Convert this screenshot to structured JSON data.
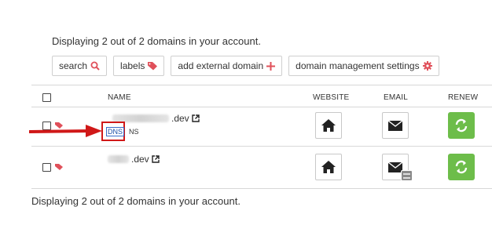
{
  "summary_text": "Displaying 2 out of 2 domains in your account.",
  "toolbar": {
    "search": "search",
    "labels": "labels",
    "add_external": "add external domain",
    "settings": "domain management settings"
  },
  "table": {
    "headers": {
      "name": "NAME",
      "website": "WEBSITE",
      "email": "EMAIL",
      "renew": "RENEW"
    },
    "rows": [
      {
        "tld": ".dev",
        "dns": "DNS",
        "ns": "NS"
      },
      {
        "tld": ".dev"
      }
    ]
  },
  "colors": {
    "accent_red": "#e0505a",
    "renew_green": "#6dbd4a",
    "annotation_red": "#d01818"
  },
  "icons": [
    "search-icon",
    "tag-icon",
    "plus-icon",
    "gear-icon",
    "external-link-icon",
    "home-icon",
    "envelope-icon",
    "refresh-icon",
    "server-icon",
    "arrow-annotation"
  ]
}
